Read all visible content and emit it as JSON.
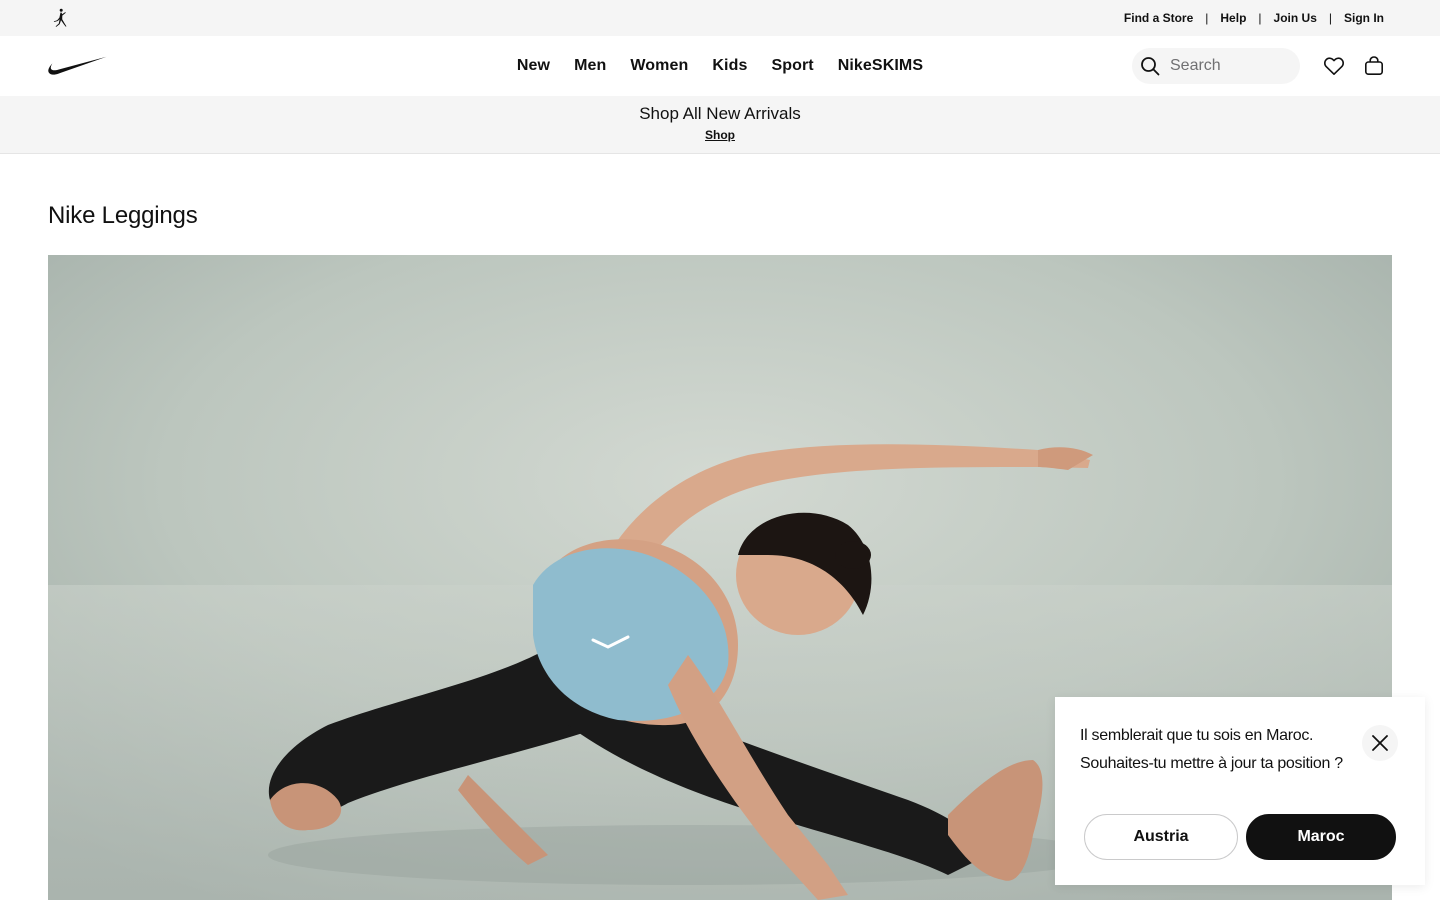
{
  "utility_bar": {
    "logo_icon": "jordan-jumpman-icon",
    "links": [
      "Find a Store",
      "Help",
      "Join Us",
      "Sign In"
    ],
    "separator": "|"
  },
  "header": {
    "logo_icon": "nike-swoosh-icon",
    "nav": [
      "New",
      "Men",
      "Women",
      "Kids",
      "Sport",
      "NikeSKIMS"
    ],
    "search": {
      "placeholder": "Search",
      "icon": "search-icon"
    },
    "favorites_icon": "heart-icon",
    "bag_icon": "bag-icon"
  },
  "promo": {
    "title": "Shop All New Arrivals",
    "link": "Shop"
  },
  "page": {
    "title": "Nike Leggings"
  },
  "hero": {
    "background_color": "#b9c3bb",
    "bra_color": "#8fbcce",
    "leggings_color": "#1a1a1a"
  },
  "geo_popup": {
    "message": "Il semblerait que tu sois en Maroc. Souhaites-tu mettre à jour ta position ?",
    "close_icon": "close-icon",
    "secondary_button": "Austria",
    "primary_button": "Maroc"
  },
  "colors": {
    "text": "#111111",
    "bar_bg": "#f5f5f5",
    "primary_btn_bg": "#111111"
  }
}
